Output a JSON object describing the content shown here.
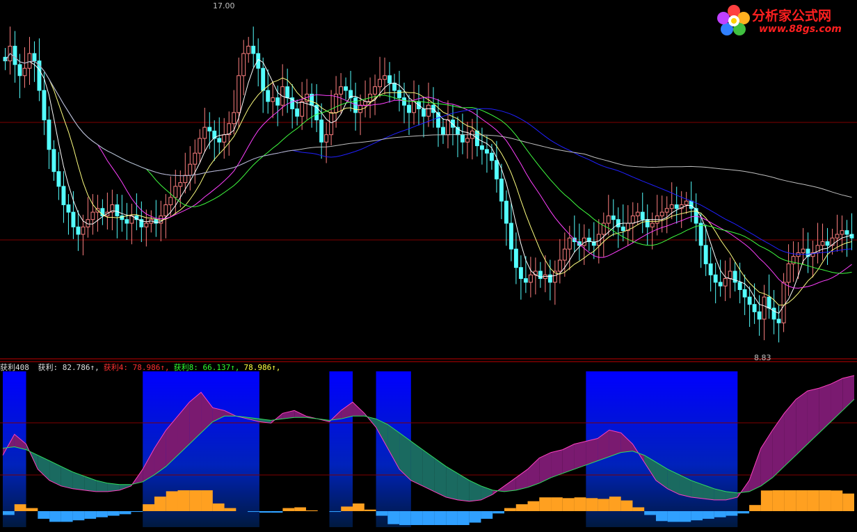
{
  "logo": {
    "name": "分析家公式网",
    "url": "www.88gs.com"
  },
  "price_panel": {
    "max_label": "17.00",
    "min_label": "8.83"
  },
  "indicator_header": {
    "name": "获利408",
    "items": [
      {
        "label": "获利:",
        "value": "82.786",
        "arrow": "↑",
        "color": "#e0e0e0"
      },
      {
        "label": "获利4:",
        "value": "78.986",
        "arrow": "↑",
        "color": "#ff3030"
      },
      {
        "label": "获利8:",
        "value": "66.137",
        "arrow": "↑",
        "color": "#30ff30"
      },
      {
        "label": "",
        "value": "78.986",
        "arrow": "↑",
        "color": "#ffff40"
      }
    ]
  },
  "chart_data": [
    {
      "type": "candlestick",
      "title": "",
      "ylim": [
        8.0,
        17.5
      ],
      "high_marker": 17.0,
      "low_marker": 8.83,
      "colors": {
        "up": "#ff8080",
        "down": "#54ffff",
        "ma1": "#ffffff",
        "ma2": "#ffff80",
        "ma3": "#ff40ff",
        "ma4": "#40ff40",
        "ma5": "#2020ff",
        "ma6": "#c0c0c0"
      },
      "close": [
        16.0,
        16.4,
        15.9,
        15.6,
        15.8,
        16.2,
        16.0,
        15.2,
        14.4,
        13.6,
        13.0,
        12.6,
        12.1,
        11.9,
        11.5,
        11.3,
        11.5,
        11.7,
        11.9,
        12.0,
        11.8,
        11.9,
        12.1,
        11.8,
        11.7,
        11.6,
        11.8,
        11.7,
        11.5,
        11.6,
        11.7,
        11.6,
        11.8,
        12.1,
        12.3,
        12.6,
        12.7,
        12.9,
        13.2,
        13.5,
        13.9,
        14.2,
        14.1,
        13.9,
        13.8,
        14.0,
        14.3,
        14.6,
        15.6,
        16.2,
        16.4,
        16.2,
        15.8,
        15.2,
        14.9,
        15.0,
        14.8,
        15.3,
        15.0,
        14.7,
        14.5,
        14.9,
        15.1,
        14.8,
        14.4,
        13.8,
        14.0,
        14.6,
        15.1,
        15.3,
        15.2,
        15.0,
        14.6,
        14.8,
        14.9,
        15.1,
        15.3,
        15.5,
        15.6,
        15.4,
        15.2,
        15.0,
        14.8,
        14.6,
        14.9,
        14.7,
        14.5,
        14.8,
        14.6,
        14.2,
        14.0,
        14.4,
        14.2,
        14.0,
        13.8,
        13.9,
        14.1,
        13.7,
        13.6,
        13.5,
        13.3,
        12.8,
        12.2,
        11.6,
        10.9,
        10.4,
        10.1,
        10.0,
        10.2,
        10.3,
        10.1,
        10.2,
        10.0,
        10.3,
        10.6,
        10.9,
        11.2,
        11.1,
        11.0,
        11.2,
        11.1,
        11.0,
        11.3,
        11.6,
        11.8,
        11.7,
        11.5,
        11.4,
        11.6,
        11.8,
        11.9,
        11.7,
        11.5,
        11.6,
        11.8,
        11.9,
        12.0,
        12.1,
        12.0,
        12.1,
        12.2,
        12.0,
        11.6,
        11.0,
        10.5,
        10.2,
        10.0,
        9.9,
        10.1,
        10.3,
        10.0,
        9.8,
        9.6,
        9.4,
        9.2,
        9.0,
        9.6,
        9.3,
        9.0,
        8.9,
        10.0,
        10.5,
        10.7,
        10.8,
        10.9,
        10.7,
        10.8,
        11.0,
        11.1,
        11.0,
        11.2,
        11.3,
        11.4,
        11.3,
        11.2
      ],
      "ma_windows": [
        5,
        10,
        20,
        30,
        60,
        120
      ]
    },
    {
      "type": "area",
      "title": "获利408",
      "ylim": [
        0,
        100
      ],
      "series": [
        {
          "name": "获利",
          "color": "#ff40c0",
          "values": [
            40,
            55,
            48,
            30,
            22,
            18,
            16,
            15,
            14,
            14,
            15,
            18,
            30,
            45,
            58,
            68,
            78,
            85,
            74,
            72,
            68,
            66,
            64,
            63,
            70,
            72,
            68,
            66,
            64,
            72,
            78,
            70,
            60,
            45,
            30,
            22,
            18,
            14,
            10,
            8,
            7,
            8,
            12,
            18,
            24,
            30,
            38,
            42,
            44,
            48,
            50,
            52,
            58,
            56,
            48,
            35,
            22,
            16,
            12,
            10,
            9,
            8,
            8,
            10,
            22,
            45,
            58,
            70,
            80,
            86,
            88,
            91,
            95,
            97
          ]
        },
        {
          "name": "获利8",
          "color": "#30e060",
          "values": [
            45,
            46,
            44,
            40,
            36,
            32,
            28,
            25,
            22,
            20,
            19,
            19,
            21,
            26,
            32,
            40,
            48,
            56,
            64,
            68,
            68,
            67,
            66,
            65,
            66,
            67,
            67,
            66,
            65,
            66,
            68,
            68,
            66,
            62,
            56,
            50,
            44,
            38,
            32,
            27,
            22,
            18,
            15,
            14,
            15,
            17,
            20,
            24,
            27,
            30,
            33,
            36,
            39,
            42,
            43,
            40,
            35,
            30,
            26,
            22,
            19,
            16,
            14,
            13,
            14,
            18,
            24,
            32,
            40,
            48,
            56,
            64,
            72,
            80
          ]
        }
      ],
      "blue_zones": [
        [
          0,
          2
        ],
        [
          12,
          22
        ],
        [
          28,
          30
        ],
        [
          32,
          35
        ],
        [
          50,
          63
        ],
        [
          74,
          96
        ]
      ],
      "bars_pos_color": "#ffa020",
      "bars_neg_color": "#30a0ff"
    }
  ]
}
